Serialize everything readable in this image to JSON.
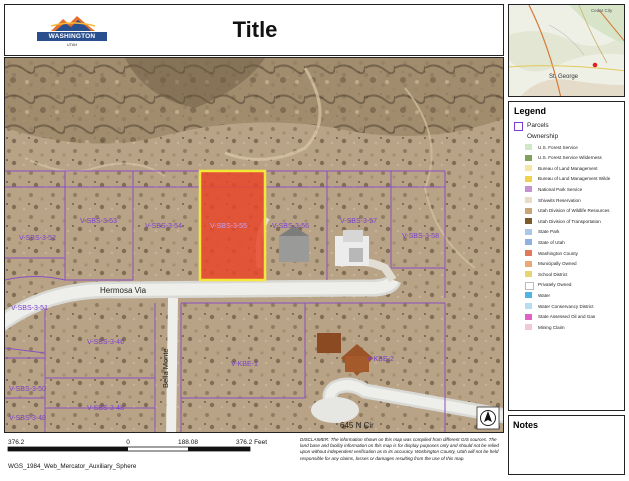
{
  "header": {
    "title": "Title",
    "logo_text": "WASHINGTON COUNTY",
    "logo_est": "UTAH"
  },
  "mini_map": {
    "city_label": "St. George",
    "corner_label": "Cedar City"
  },
  "map": {
    "parcels": [
      "V-SBS-3-55",
      "V-SBS-3-54",
      "V-SBS-3-53",
      "V-SBS-3-52",
      "V-SBS-3-56",
      "V-SBS-3-57",
      "V-SBS-3-58",
      "V-SBS-3-51",
      "V-SBS-3-46",
      "V-SBS-3-50",
      "V-SBS-3-49",
      "V-SBS-3-48",
      "V-KBE-1",
      "V-KBE-2"
    ],
    "streets": [
      "Hermosa Via",
      "Bella Monte",
      "645 N Cir"
    ],
    "selected_parcel": "V-SBS-3-55",
    "selected_color": "#e8472a"
  },
  "legend": {
    "title": "Legend",
    "parcels_label": "Parcels",
    "ownership_label": "Ownership",
    "items": [
      {
        "label": "U.S. Forest Service",
        "color": "#cfe8c8"
      },
      {
        "label": "U.S. Forest Service Wilderness",
        "color": "#7fa15a"
      },
      {
        "label": "Bureau of Land Management",
        "color": "#f5e6a8"
      },
      {
        "label": "Bureau of Land Management Wilde",
        "color": "#f0d34a"
      },
      {
        "label": "National Park Service",
        "color": "#c690d4"
      },
      {
        "label": "Shivwits Reservation",
        "color": "#e8dcc8"
      },
      {
        "label": "Utah Division of Wildlife Resources",
        "color": "#c9a478"
      },
      {
        "label": "Utah Division of Transportation",
        "color": "#7a5a2b"
      },
      {
        "label": "State Park",
        "color": "#a9c8e8"
      },
      {
        "label": "State of Utah",
        "color": "#8fb0e0"
      },
      {
        "label": "Washington County",
        "color": "#e0785a"
      },
      {
        "label": "Municipally Owned",
        "color": "#e8a878"
      },
      {
        "label": "School District",
        "color": "#e8d470"
      },
      {
        "label": "Privately Owned",
        "color": "#ffffff"
      },
      {
        "label": "Water",
        "color": "#4fb4e4"
      },
      {
        "label": "Water Conservancy District",
        "color": "#b8dcf0"
      },
      {
        "label": "State Assessed Oil and Gas",
        "color": "#e060c8"
      },
      {
        "label": "Mining Claim",
        "color": "#f0c8d8"
      }
    ]
  },
  "notes": {
    "title": "Notes"
  },
  "scale": {
    "ticks": [
      "376.2",
      "0",
      "188.08",
      "376.2 Feet"
    ],
    "projection": "WGS_1984_Web_Mercator_Auxiliary_Sphere"
  },
  "disclaimer": "DISCLAIMER: The information shown on this map was compiled from different GIS sources. The land base and facility information on this map is for display purposes only and should not be relied upon without independent verification as to its accuracy. Washington County, Utah will not be held responsible for any claims, losses or damages resulting from the use of this map.",
  "north_arrow": {
    "label": "N"
  }
}
